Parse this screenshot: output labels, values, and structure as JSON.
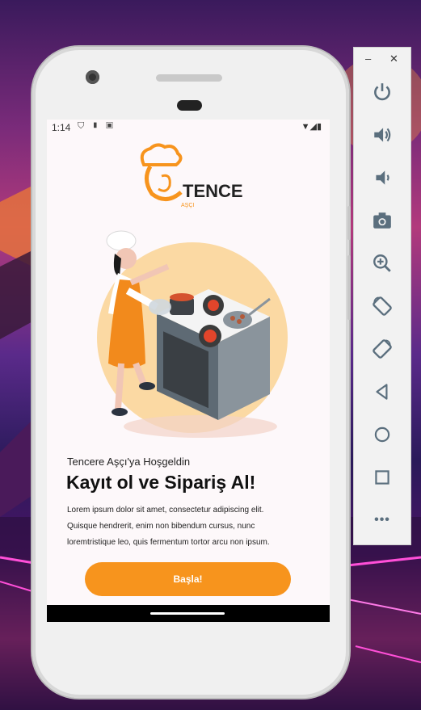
{
  "status_bar": {
    "time": "1:14",
    "left_icons": "⛉ ▮ ▣",
    "right_icons": "▼◢▮"
  },
  "logo": {
    "brand": "TENCERE",
    "sub": "AŞÇI"
  },
  "content": {
    "welcome": "Tencere Aşçı'ya Hoşgeldin",
    "headline": "Kayıt ol ve Sipariş Al!",
    "body_line1": "Lorem ipsum dolor sit amet, consectetur adipiscing elit.",
    "body_line2": "Quisque hendrerit, enim non bibendum cursus, nunc",
    "body_line3": "loremtristique leo, quis fermentum tortor arcu non ipsum.",
    "start_button": "Başla!"
  },
  "emulator_toolbar": {
    "minimize": "–",
    "close": "✕",
    "buttons": [
      "power-icon",
      "volume-up-icon",
      "volume-down-icon",
      "camera-icon",
      "zoom-in-icon",
      "rotate-left-icon",
      "rotate-right-icon",
      "back-icon",
      "home-icon",
      "overview-icon",
      "more-icon"
    ],
    "more": "•••"
  },
  "colors": {
    "accent": "#f7941d",
    "screen_bg": "#fdf8fa",
    "toolbar_icon": "#5b6f7e"
  }
}
